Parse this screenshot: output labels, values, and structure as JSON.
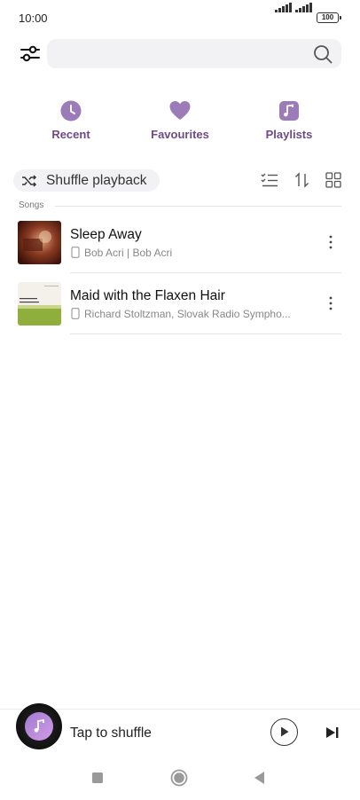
{
  "status": {
    "time": "10:00",
    "battery": "100"
  },
  "search": {
    "placeholder": ""
  },
  "quick_actions": [
    {
      "label": "Recent",
      "icon": "clock-icon"
    },
    {
      "label": "Favourites",
      "icon": "heart-icon"
    },
    {
      "label": "Playlists",
      "icon": "music-note-icon"
    }
  ],
  "toolbar": {
    "shuffle_label": "Shuffle playback"
  },
  "songs_section": {
    "title": "Songs"
  },
  "songs": [
    {
      "title": "Sleep Away",
      "subtitle": "Bob Acri | Bob Acri"
    },
    {
      "title": "Maid with the Flaxen Hair",
      "subtitle": "Richard Stoltzman, Slovak Radio Sympho..."
    }
  ],
  "player": {
    "label": "Tap to shuffle"
  },
  "colors": {
    "accent": "#9b7bb8",
    "accent_text": "#6e4a86"
  }
}
